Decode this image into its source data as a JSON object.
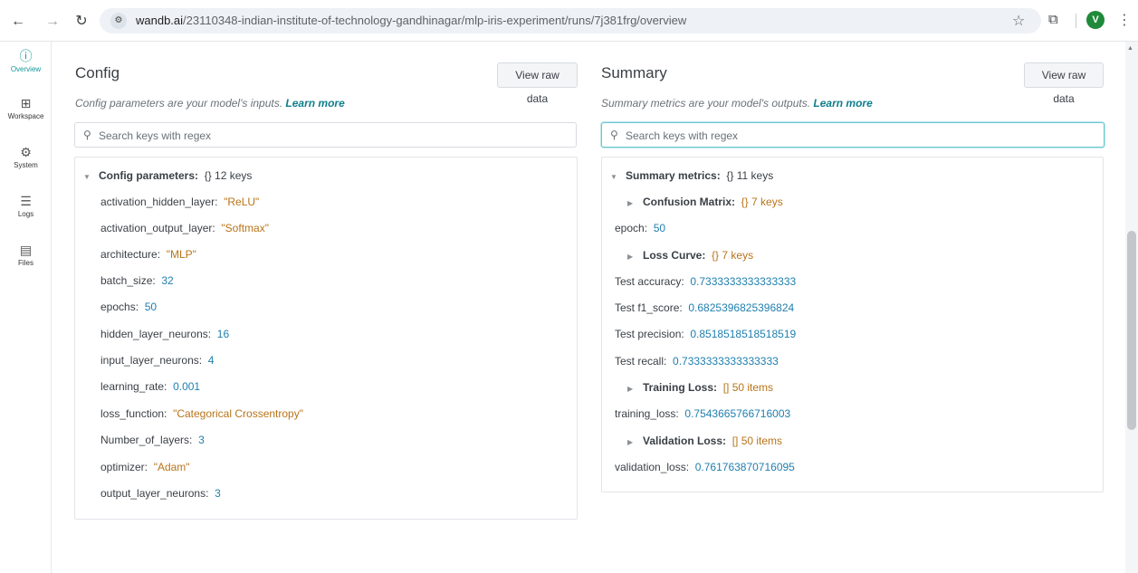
{
  "browser": {
    "url_host": "wandb.ai",
    "url_path": "/23110348-indian-institute-of-technology-gandhinagar/mlp-iris-experiment/runs/7j381frg/overview",
    "profile_initial": "V"
  },
  "sidebar": {
    "items": [
      {
        "label": "Overview",
        "icon": "info-icon"
      },
      {
        "label": "Workspace",
        "icon": "workspace-icon"
      },
      {
        "label": "System",
        "icon": "chip-icon"
      },
      {
        "label": "Logs",
        "icon": "list-icon"
      },
      {
        "label": "Files",
        "icon": "file-icon"
      }
    ]
  },
  "config": {
    "title": "Config",
    "raw_label": "View raw data",
    "description": "Config parameters are your model's inputs.",
    "learn_more": "Learn more",
    "search_placeholder": "Search keys with regex",
    "group_label": "Config parameters:",
    "group_meta": "{} 12 keys",
    "rows": [
      {
        "key": "activation_hidden_layer:",
        "value": "\"ReLU\""
      },
      {
        "key": "activation_output_layer:",
        "value": "\"Softmax\""
      },
      {
        "key": "architecture:",
        "value": "\"MLP\""
      },
      {
        "key": "batch_size:",
        "value": "32"
      },
      {
        "key": "epochs:",
        "value": "50"
      },
      {
        "key": "hidden_layer_neurons:",
        "value": "16"
      },
      {
        "key": "input_layer_neurons:",
        "value": "4"
      },
      {
        "key": "learning_rate:",
        "value": "0.001"
      },
      {
        "key": "loss_function:",
        "value": "\"Categorical Crossentropy\""
      },
      {
        "key": "Number_of_layers:",
        "value": "3"
      },
      {
        "key": "optimizer:",
        "value": "\"Adam\""
      },
      {
        "key": "output_layer_neurons:",
        "value": "3"
      }
    ]
  },
  "summary": {
    "title": "Summary",
    "raw_label": "View raw data",
    "description": "Summary metrics are your model's outputs.",
    "learn_more": "Learn more",
    "search_placeholder": "Search keys with regex",
    "group_label": "Summary metrics:",
    "group_meta": "{} 11 keys",
    "rows": [
      {
        "key": "Confusion Matrix:",
        "value": "{} 7 keys"
      },
      {
        "key": "epoch:",
        "value": "50"
      },
      {
        "key": "Loss Curve:",
        "value": "{} 7 keys"
      },
      {
        "key": "Test accuracy:",
        "value": "0.7333333333333333"
      },
      {
        "key": "Test f1_score:",
        "value": "0.6825396825396824"
      },
      {
        "key": "Test precision:",
        "value": "0.8518518518518519"
      },
      {
        "key": "Test recall:",
        "value": "0.7333333333333333"
      },
      {
        "key": "Training Loss:",
        "value": "[] 50 items"
      },
      {
        "key": "training_loss:",
        "value": "0.7543665766716003"
      },
      {
        "key": "Validation Loss:",
        "value": "[] 50 items"
      },
      {
        "key": "validation_loss:",
        "value": "0.761763870716095"
      }
    ]
  }
}
